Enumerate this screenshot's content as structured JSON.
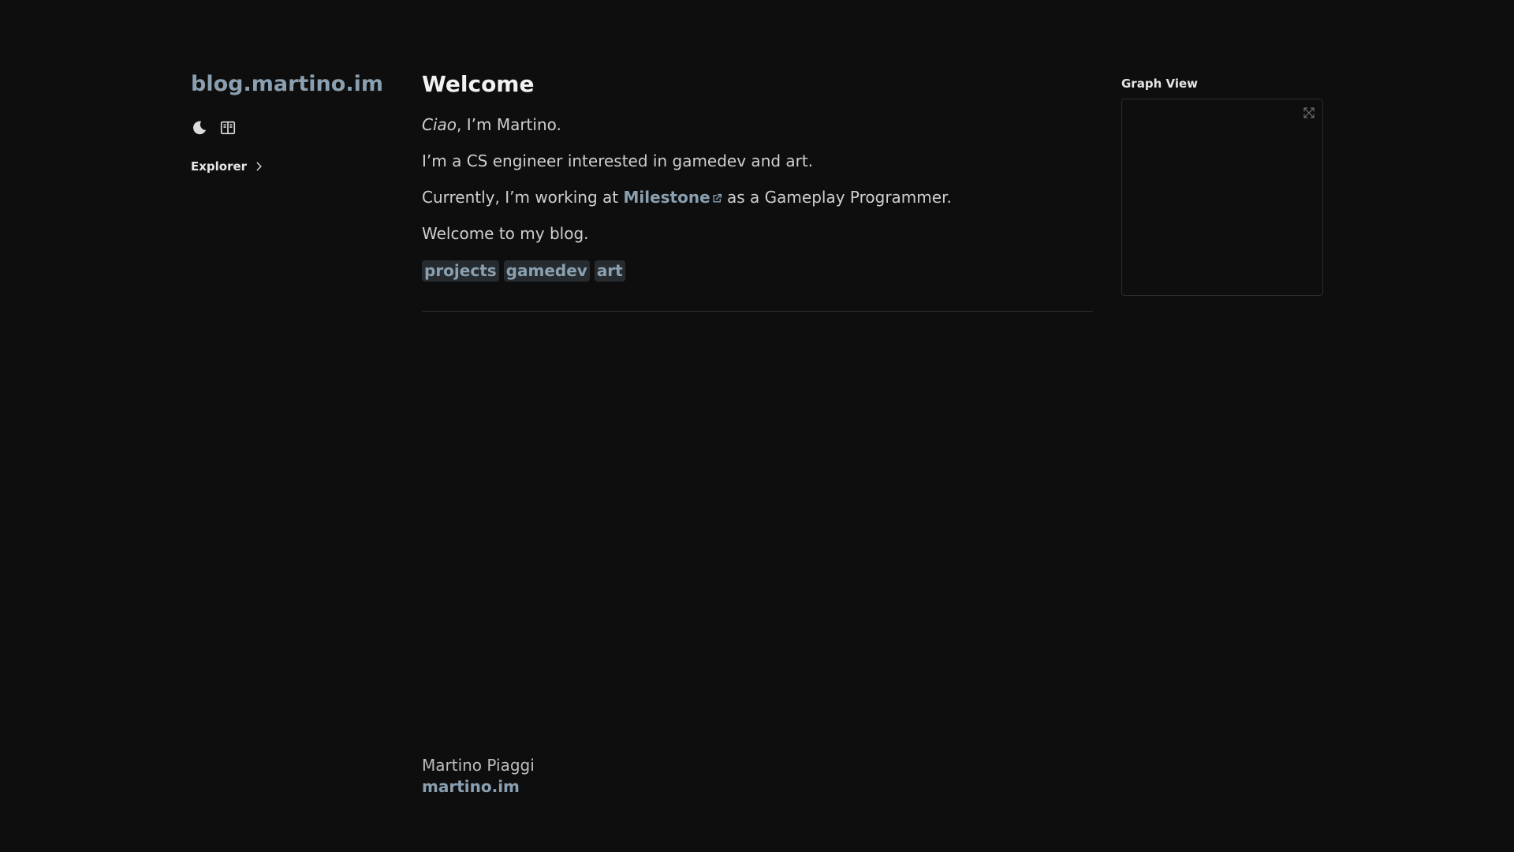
{
  "site": {
    "title": "blog.martino.im"
  },
  "sidebar": {
    "icons": [
      "moon-icon",
      "book-icon"
    ],
    "explorer_label": "Explorer"
  },
  "main": {
    "title": "Welcome",
    "p1_em": "Ciao",
    "p1_rest": ", I’m Martino.",
    "p2": "I’m a CS engineer interested in gamedev and art.",
    "p3_before": "Currently, I’m working at ",
    "p3_link": "Milestone",
    "p3_after": " as a Gameplay Programmer.",
    "p4": "Welcome to my blog.",
    "tags": [
      "projects",
      "gamedev",
      "art"
    ]
  },
  "graph": {
    "title": "Graph View"
  },
  "footer": {
    "name": "Martino Piaggi",
    "link": "martino.im"
  },
  "colors": {
    "background": "#0e0e0e",
    "accent": "#8aa0b0",
    "text": "#cfcfcf",
    "tag_bg": "#262b2f"
  }
}
